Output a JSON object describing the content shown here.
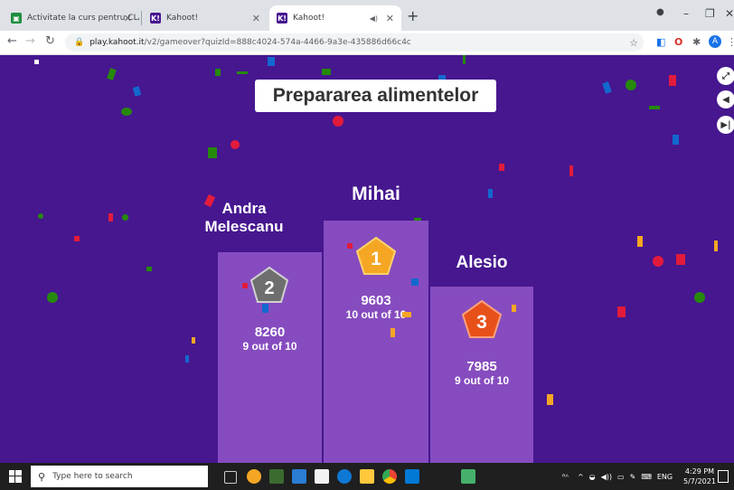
{
  "browser": {
    "tabs": [
      {
        "title": "Activitate la curs pentru CLASA a",
        "favicon": "classroom-icon",
        "favicon_color": "#1e8e3e",
        "active": false
      },
      {
        "title": "Kahoot!",
        "favicon": "kahoot-icon",
        "favicon_color": "#46178f",
        "active": false
      },
      {
        "title": "Kahoot!",
        "favicon": "kahoot-icon",
        "favicon_color": "#46178f",
        "active": true
      }
    ],
    "new_tab": "+",
    "url_host": "play.kahoot.it",
    "url_path": "/v2/gameover?quizId=888c4024-574a-4466-9a3e-435886d66c4c",
    "profile_initial": "A"
  },
  "game": {
    "title": "Prepararea alimentelor",
    "podium": [
      {
        "place": "1",
        "name": "Mihai",
        "score": "9603",
        "correct": "10 out of 10",
        "medal_color": "#f5a623"
      },
      {
        "place": "2",
        "name": "Andra Melescanu",
        "score": "8260",
        "correct": "9 out of 10",
        "medal_color": "#6e6e6e"
      },
      {
        "place": "3",
        "name": "Alesio",
        "score": "7985",
        "correct": "9 out of 10",
        "medal_color": "#e8501a"
      }
    ],
    "background_color": "#46178f",
    "podium_color": "#864cbf"
  },
  "taskbar": {
    "search_placeholder": "Type here to search",
    "language": "ENG",
    "time": "4:29 PM",
    "date": "5/7/2021"
  }
}
